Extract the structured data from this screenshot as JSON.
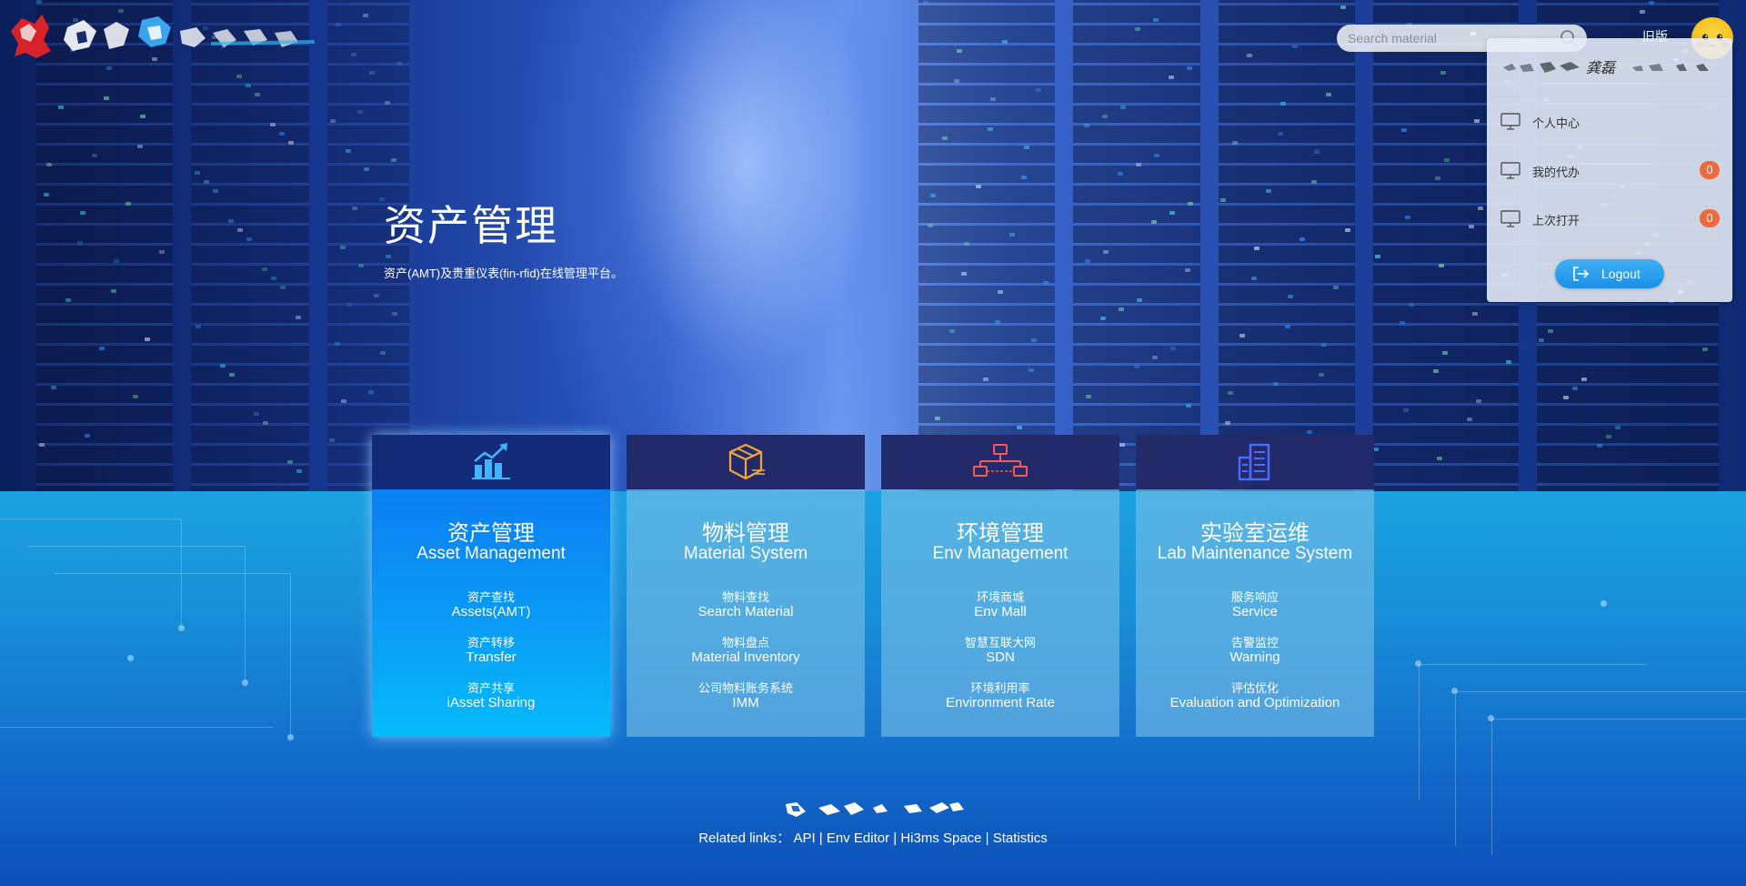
{
  "header": {
    "search_placeholder": "Search material",
    "old_version_label": "旧版"
  },
  "user_menu": {
    "user_name": "龚磊",
    "items": [
      {
        "label": "个人中心",
        "badge": ""
      },
      {
        "label": "我的代办",
        "badge": "0"
      },
      {
        "label": "上次打开",
        "badge": "0"
      }
    ],
    "logout_label": "Logout"
  },
  "hero": {
    "title": "资产管理",
    "subtitle": "资产(AMT)及贵重仪表(fin-rfid)在线管理平台。"
  },
  "cards": [
    {
      "title_cn": "资产管理",
      "title_en": "Asset Management",
      "links": [
        {
          "cn": "资产查找",
          "en": "Assets(AMT)"
        },
        {
          "cn": "资产转移",
          "en": "Transfer"
        },
        {
          "cn": "资产共享",
          "en": "iAsset Sharing"
        }
      ]
    },
    {
      "title_cn": "物料管理",
      "title_en": "Material System",
      "links": [
        {
          "cn": "物料查找",
          "en": "Search Material"
        },
        {
          "cn": "物料盘点",
          "en": "Material Inventory"
        },
        {
          "cn": "公司物料账务系统",
          "en": "IMM"
        }
      ]
    },
    {
      "title_cn": "环境管理",
      "title_en": "Env Management",
      "links": [
        {
          "cn": "环境商城",
          "en": "Env Mall"
        },
        {
          "cn": "智慧互联大网",
          "en": "SDN"
        },
        {
          "cn": "环境利用率",
          "en": "Environment Rate"
        }
      ]
    },
    {
      "title_cn": "实验室运维",
      "title_en": "Lab Maintenance System",
      "links": [
        {
          "cn": "服务响应",
          "en": "Service"
        },
        {
          "cn": "告警监控",
          "en": "Warning"
        },
        {
          "cn": "评估优化",
          "en": "Evaluation and Optimization"
        }
      ]
    }
  ],
  "footer": {
    "prefix": "Related links：",
    "links": [
      "API",
      "Env Editor",
      "Hi3ms Space",
      "Statistics"
    ],
    "separator": " | "
  },
  "colors": {
    "active_card_top": "#0b7ff2",
    "active_card_bottom": "#05bcfa",
    "card_head": "#222a6a",
    "badge": "#ee6a3d",
    "logout_button": "#1b8ee6"
  },
  "icons": {
    "search": "search-icon",
    "menu_items": "monitor-icon",
    "logout": "logout-icon",
    "card_icons": [
      "chart-growth-icon",
      "box-icon",
      "network-icon",
      "building-icon"
    ]
  }
}
